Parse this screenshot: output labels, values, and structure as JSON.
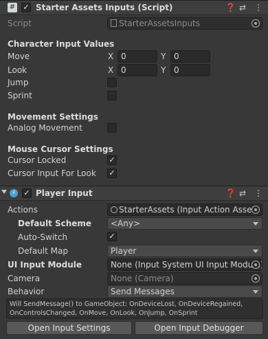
{
  "starter": {
    "title": "Starter Assets Inputs (Script)",
    "enabled": true,
    "script_label": "Script",
    "script_value": "StarterAssetsInputs",
    "sections": {
      "character": "Character Input Values",
      "movement": "Movement Settings",
      "cursor": "Mouse Cursor Settings"
    },
    "move": {
      "label": "Move",
      "x_label": "X",
      "x": "0",
      "y_label": "Y",
      "y": "0"
    },
    "look": {
      "label": "Look",
      "x_label": "X",
      "x": "0",
      "y_label": "Y",
      "y": "0"
    },
    "jump": {
      "label": "Jump",
      "checked": false
    },
    "sprint": {
      "label": "Sprint",
      "checked": false
    },
    "analog": {
      "label": "Analog Movement",
      "checked": false
    },
    "cursor_locked": {
      "label": "Cursor Locked",
      "checked": true
    },
    "cursor_look": {
      "label": "Cursor Input For Look",
      "checked": true
    }
  },
  "player_input": {
    "title": "Player Input",
    "enabled": true,
    "actions": {
      "label": "Actions",
      "value": "StarterAssets (Input Action Asset)"
    },
    "default_scheme": {
      "label": "Default Scheme",
      "value": "<Any>"
    },
    "auto_switch": {
      "label": "Auto-Switch",
      "checked": true
    },
    "default_map": {
      "label": "Default Map",
      "value": "Player"
    },
    "ui_module": {
      "label": "UI Input Module",
      "value": "None (Input System UI Input Module)"
    },
    "camera": {
      "label": "Camera",
      "value": "None (Camera)"
    },
    "behavior": {
      "label": "Behavior",
      "value": "Send Messages"
    },
    "help_text": "Will SendMessage() to GameObject: OnDeviceLost, OnDeviceRegained, OnControlsChanged, OnMove, OnLook, OnJump, OnSprint",
    "open_settings": "Open Input Settings",
    "open_debugger": "Open Input Debugger"
  },
  "colors": {
    "background": "#383838",
    "header": "#3e3e3e",
    "field": "#2a2a2a",
    "dropdown": "#4a4a4a",
    "button": "#585858"
  }
}
